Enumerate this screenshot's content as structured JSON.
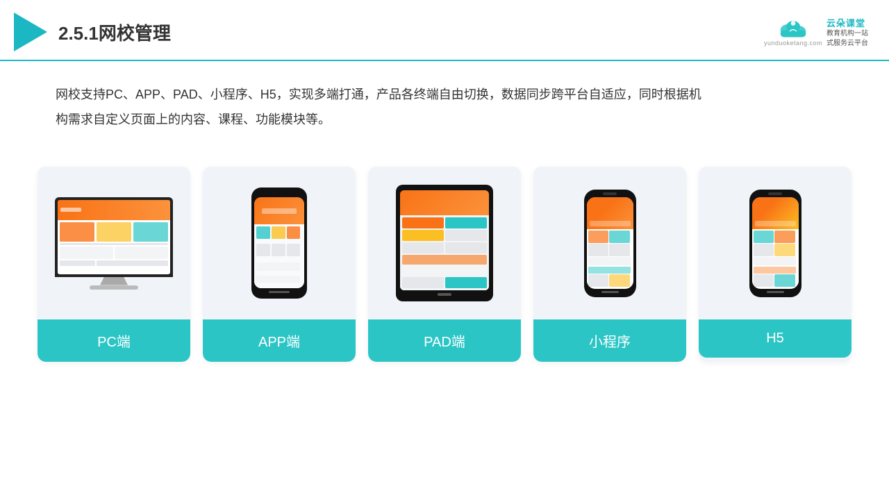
{
  "header": {
    "title": "2.5.1网校管理",
    "brand": {
      "name": "云朵课堂",
      "url": "yunduoketang.com",
      "slogan_line1": "教育机构一站",
      "slogan_line2": "式服务云平台"
    }
  },
  "description": {
    "text": "网校支持PC、APP、PAD、小程序、H5，实现多端打通，产品各终端自由切换，数据同步跨平台自适应，同时根据机构需求自定义页面上的内容、课程、功能模块等。"
  },
  "cards": [
    {
      "id": "pc",
      "label": "PC端"
    },
    {
      "id": "app",
      "label": "APP端"
    },
    {
      "id": "pad",
      "label": "PAD端"
    },
    {
      "id": "miniprogram",
      "label": "小程序"
    },
    {
      "id": "h5",
      "label": "H5"
    }
  ],
  "colors": {
    "teal": "#2cc5c5",
    "accent": "#f97316",
    "dark": "#333",
    "light_bg": "#f0f4f8"
  }
}
